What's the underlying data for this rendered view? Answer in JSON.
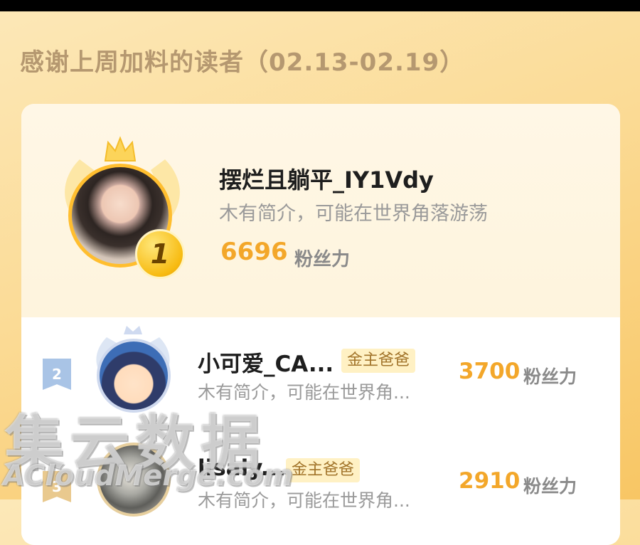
{
  "header": {
    "title": "感谢上周加料的读者（02.13-02.19）"
  },
  "leaderboard": {
    "score_unit": "粉丝力",
    "colors": {
      "accent": "#f3a72a",
      "title": "#b59870",
      "tag_bg": "#fff1c4",
      "tag_text": "#a2742a"
    },
    "top": {
      "rank": "1",
      "name": "摆烂且躺平_IY1Vdy",
      "bio": "木有简介，可能在世界角落游荡",
      "score": "6696",
      "icons": [
        "crown-icon",
        "wings-icon",
        "gold-medal-icon"
      ]
    },
    "entries": [
      {
        "rank": "2",
        "name": "小可爱_CA...",
        "tag": "金主爸爸",
        "bio": "木有简介，可能在世界角...",
        "score": "3700"
      },
      {
        "rank": "3",
        "name": "lisaly...",
        "tag": "金主爸爸",
        "bio": "木有简介，可能在世界角...",
        "score": "2910"
      }
    ]
  },
  "watermark": {
    "main": "集云数据",
    "sub": "ACloudMerge.com"
  }
}
